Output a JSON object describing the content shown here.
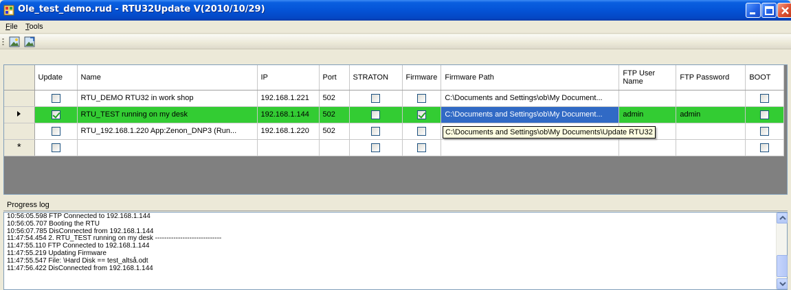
{
  "window": {
    "title": "Ole_test_demo.rud - RTU32Update V(2010/10/29)"
  },
  "menu": {
    "file": {
      "underline": "F",
      "rest": "ile"
    },
    "tools": {
      "underline": "T",
      "rest": "ools"
    }
  },
  "toolbar": {
    "buttons": [
      {
        "icon": "image-open-icon"
      },
      {
        "icon": "image-save-icon"
      }
    ]
  },
  "grid": {
    "columns": [
      "Update",
      "Name",
      "IP",
      "Port",
      "STRATON",
      "Firmware",
      "Firmware Path",
      "FTP User Name",
      "FTP Password",
      "BOOT"
    ],
    "rows": [
      {
        "indicator": "",
        "update": false,
        "name": "RTU_DEMO RTU32 in work shop",
        "ip": "192.168.1.221",
        "port": "502",
        "straton": false,
        "firmware": false,
        "firmware_path": "C:\\Documents and Settings\\ob\\My Document...",
        "ftp_user": "",
        "ftp_password": "",
        "boot": false
      },
      {
        "indicator": "current",
        "update": true,
        "name": "RTU_TEST running on my desk",
        "ip": "192.168.1.144",
        "port": "502",
        "straton": false,
        "firmware": true,
        "firmware_path": "C:\\Documents and Settings\\ob\\My Document...",
        "ftp_user": "admin",
        "ftp_password": "admin",
        "boot": false
      },
      {
        "indicator": "",
        "update": false,
        "name": "RTU_192.168.1.220  App:Zenon_DNP3 (Run...",
        "ip": "192.168.1.220",
        "port": "502",
        "straton": false,
        "firmware": false,
        "firmware_path": "",
        "ftp_user": "",
        "ftp_password": "",
        "boot": false
      },
      {
        "indicator": "new",
        "update": false,
        "name": "",
        "ip": "",
        "port": "",
        "straton": false,
        "firmware": false,
        "firmware_path": "",
        "ftp_user": "",
        "ftp_password": "",
        "boot": false
      }
    ],
    "tooltip": "C:\\Documents and Settings\\ob\\My Documents\\Update RTU32"
  },
  "log": {
    "header": "Progress log",
    "lines": [
      "10:56:05.598 FTP Connected to 192.168.1.144",
      "10:56:05.707 Booting the RTU",
      "10:56:07.785 DisConnected from 192.168.1.144",
      "11:47:54.454 2. RTU_TEST running on my desk -----------------------------",
      "11:47:55.110 FTP Connected to 192.168.1.144",
      "11:47:55.219 Updating Firmware",
      "11:47:55.547 File: \\Hard Disk == test_altså.odt",
      "11:47:56.422 DisConnected from 192.168.1.144"
    ]
  },
  "colors": {
    "title_bar": "#0453d6",
    "selected_row": "#33cc33",
    "active_cell": "#316ac5",
    "tooltip_bg": "#ffffe1"
  }
}
